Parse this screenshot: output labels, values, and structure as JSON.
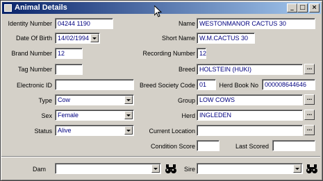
{
  "window": {
    "title": "Animal Details",
    "controls": {
      "minimize": "_",
      "maximize": "□",
      "close": "×"
    }
  },
  "left": {
    "identity_number": {
      "label": "Identity Number",
      "value": "04244  1190"
    },
    "date_of_birth": {
      "label": "Date Of Birth",
      "value": "14/02/1994"
    },
    "brand_number": {
      "label": "Brand Number",
      "value": "12"
    },
    "tag_number": {
      "label": "Tag Number",
      "value": ""
    },
    "electronic_id": {
      "label": "Electronic ID",
      "value": ""
    },
    "type": {
      "label": "Type",
      "value": "Cow"
    },
    "sex": {
      "label": "Sex",
      "value": "Female"
    },
    "status": {
      "label": "Status",
      "value": "Alive"
    }
  },
  "right": {
    "name": {
      "label": "Name",
      "value": "WESTONMANOR CACTUS 30"
    },
    "short_name": {
      "label": "Short Name",
      "value": "W.M.CACTUS 30"
    },
    "recording_number": {
      "label": "Recording Number",
      "value": "12"
    },
    "breed": {
      "label": "Breed",
      "value": "HOLSTEIN  (HUKI)"
    },
    "breed_society_code": {
      "label": "Breed Society Code",
      "value": "01"
    },
    "herd_book_no": {
      "label": "Herd Book No",
      "value": "000008644646"
    },
    "group": {
      "label": "Group",
      "value": "LOW COWS"
    },
    "herd": {
      "label": "Herd",
      "value": "INGLEDEN"
    },
    "current_location": {
      "label": "Current Location",
      "value": ""
    },
    "condition_score": {
      "label": "Condition Score",
      "value": ""
    },
    "last_scored": {
      "label": "Last Scored",
      "value": ""
    }
  },
  "bottom": {
    "dam": {
      "label": "Dam",
      "value": ""
    },
    "sire": {
      "label": "Sire",
      "value": ""
    }
  },
  "ellipsis": "..."
}
